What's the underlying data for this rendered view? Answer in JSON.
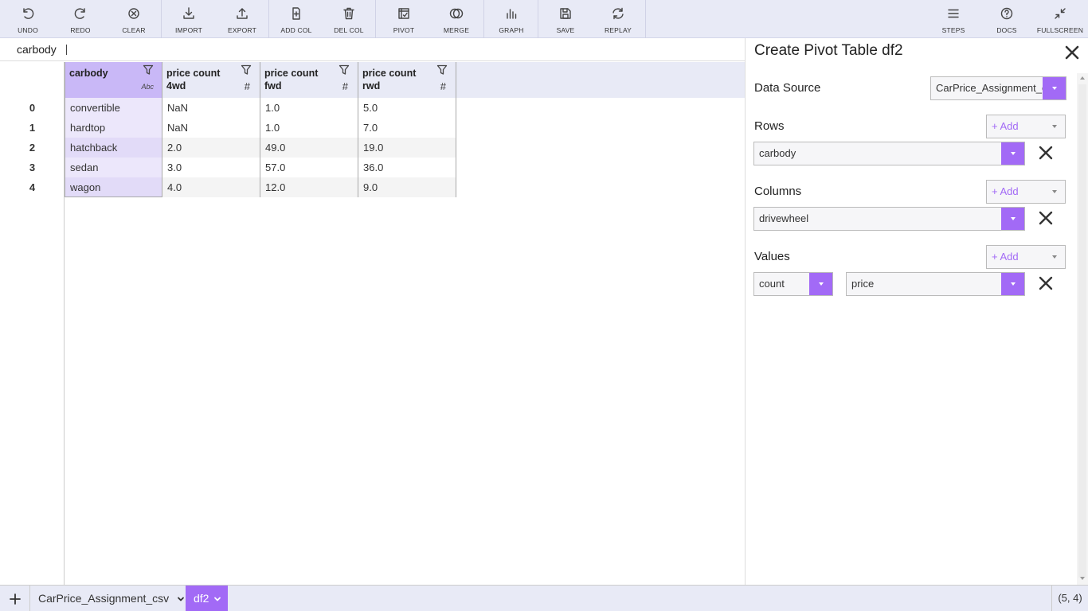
{
  "toolbar": {
    "undo": "UNDO",
    "redo": "REDO",
    "clear": "CLEAR",
    "import": "IMPORT",
    "export": "EXPORT",
    "add_col": "ADD COL",
    "del_col": "DEL COL",
    "pivot": "PIVOT",
    "merge": "MERGE",
    "graph": "GRAPH",
    "save": "SAVE",
    "replay": "REPLAY",
    "steps": "STEPS",
    "docs": "DOCS",
    "fullscreen": "FULLSCREEN"
  },
  "formula_bar": {
    "value": "carbody"
  },
  "grid": {
    "columns": [
      {
        "name": "carbody",
        "type_icon": "Abc"
      },
      {
        "name": "price count 4wd",
        "type_icon": "#"
      },
      {
        "name": "price count fwd",
        "type_icon": "#"
      },
      {
        "name": "price count rwd",
        "type_icon": "#"
      }
    ],
    "rows": [
      {
        "index": "0",
        "cells": [
          "convertible",
          "NaN",
          "1.0",
          "5.0"
        ]
      },
      {
        "index": "1",
        "cells": [
          "hardtop",
          "NaN",
          "1.0",
          "7.0"
        ]
      },
      {
        "index": "2",
        "cells": [
          "hatchback",
          "2.0",
          "49.0",
          "19.0"
        ]
      },
      {
        "index": "3",
        "cells": [
          "sedan",
          "3.0",
          "57.0",
          "36.0"
        ]
      },
      {
        "index": "4",
        "cells": [
          "wagon",
          "4.0",
          "12.0",
          "9.0"
        ]
      }
    ]
  },
  "panel": {
    "title": "Create Pivot Table df2",
    "data_source_label": "Data Source",
    "data_source_value": "CarPrice_Assignment_csv",
    "rows_label": "Rows",
    "rows_value": "carbody",
    "columns_label": "Columns",
    "columns_value": "drivewheel",
    "values_label": "Values",
    "values_agg": "count",
    "values_field": "price",
    "add_label": "+ Add"
  },
  "bottom": {
    "tabs": [
      {
        "label": "CarPrice_Assignment_csv",
        "active": false
      },
      {
        "label": "df2",
        "active": true
      }
    ],
    "coords": "(5, 4)"
  },
  "colors": {
    "accent": "#a26af6",
    "toolbar_bg": "#e8eaf6",
    "selected_header": "#c9b8f7",
    "selected_cell": "#ece7fb"
  }
}
